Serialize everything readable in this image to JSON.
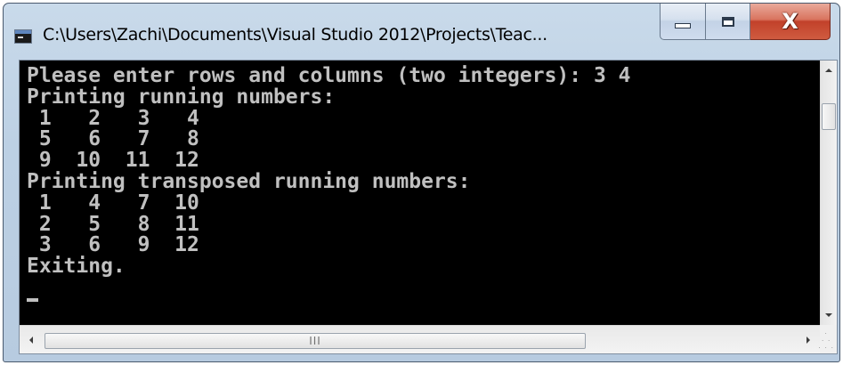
{
  "window": {
    "title": "C:\\Users\\Zachi\\Documents\\Visual Studio 2012\\Projects\\Teac...",
    "icon": "console-app-icon",
    "controls": {
      "minimize_icon": "minimize-icon",
      "maximize_icon": "maximize-icon",
      "close_icon": "close-icon",
      "close_glyph": "X"
    }
  },
  "console": {
    "background": "#000000",
    "foreground": "#c0c0c0",
    "lines": [
      "Please enter rows and columns (two integers): 3 4",
      "Printing running numbers:",
      " 1   2   3   4",
      " 5   6   7   8",
      " 9  10  11  12",
      "Printing transposed running numbers:",
      " 1   4   7  10",
      " 2   5   8  11",
      " 3   6   9  12",
      "Exiting."
    ],
    "cursor": "_"
  },
  "scrollbars": {
    "vertical": {
      "up_icon": "scroll-up-arrow-icon",
      "down_icon": "scroll-down-arrow-icon"
    },
    "horizontal": {
      "left_icon": "scroll-left-arrow-icon",
      "right_icon": "scroll-right-arrow-icon",
      "grip": "III"
    }
  },
  "colors": {
    "close_button": "#c94a32",
    "titlebar": "#bcd0e4"
  }
}
